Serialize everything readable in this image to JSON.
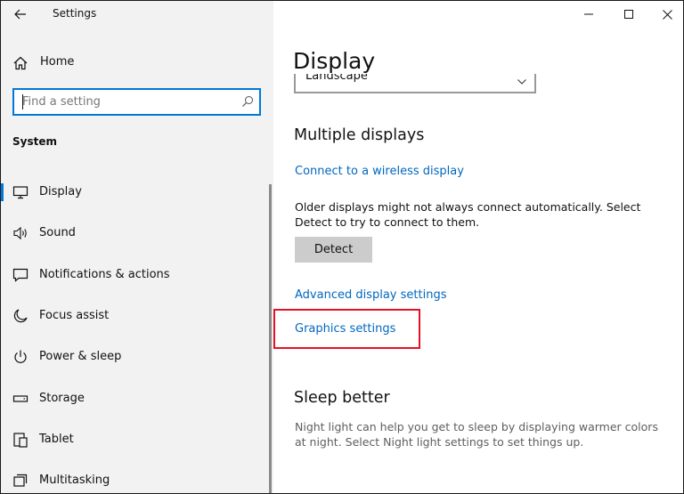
{
  "window": {
    "title": "Settings",
    "controls": {
      "minimize": "minimize-icon",
      "maximize": "maximize-icon",
      "close": "close-icon"
    }
  },
  "sidebar": {
    "home_label": "Home",
    "search": {
      "placeholder": "Find a setting",
      "value": ""
    },
    "section_label": "System",
    "items": [
      {
        "label": "Display",
        "icon": "monitor-icon",
        "selected": true
      },
      {
        "label": "Sound",
        "icon": "speaker-icon"
      },
      {
        "label": "Notifications & actions",
        "icon": "notification-icon"
      },
      {
        "label": "Focus assist",
        "icon": "moon-icon"
      },
      {
        "label": "Power & sleep",
        "icon": "power-icon"
      },
      {
        "label": "Storage",
        "icon": "storage-icon"
      },
      {
        "label": "Tablet",
        "icon": "tablet-icon"
      },
      {
        "label": "Multitasking",
        "icon": "multitasking-icon"
      }
    ]
  },
  "main": {
    "page_title": "Display",
    "orientation_value": "Landscape",
    "multiple_displays": {
      "heading": "Multiple displays",
      "wireless_link": "Connect to a wireless display",
      "description": "Older displays might not always connect automatically. Select Detect to try to connect to them.",
      "detect_label": "Detect",
      "advanced_link": "Advanced display settings",
      "graphics_link": "Graphics settings"
    },
    "sleep_better": {
      "heading": "Sleep better",
      "description": "Night light can help you get to sleep by displaying warmer colors at night. Select Night light settings to set things up."
    }
  },
  "colors": {
    "accent": "#0078d7",
    "link": "#0067c0",
    "highlight": "#e81123",
    "sidebar_bg": "#f2f2f2"
  }
}
